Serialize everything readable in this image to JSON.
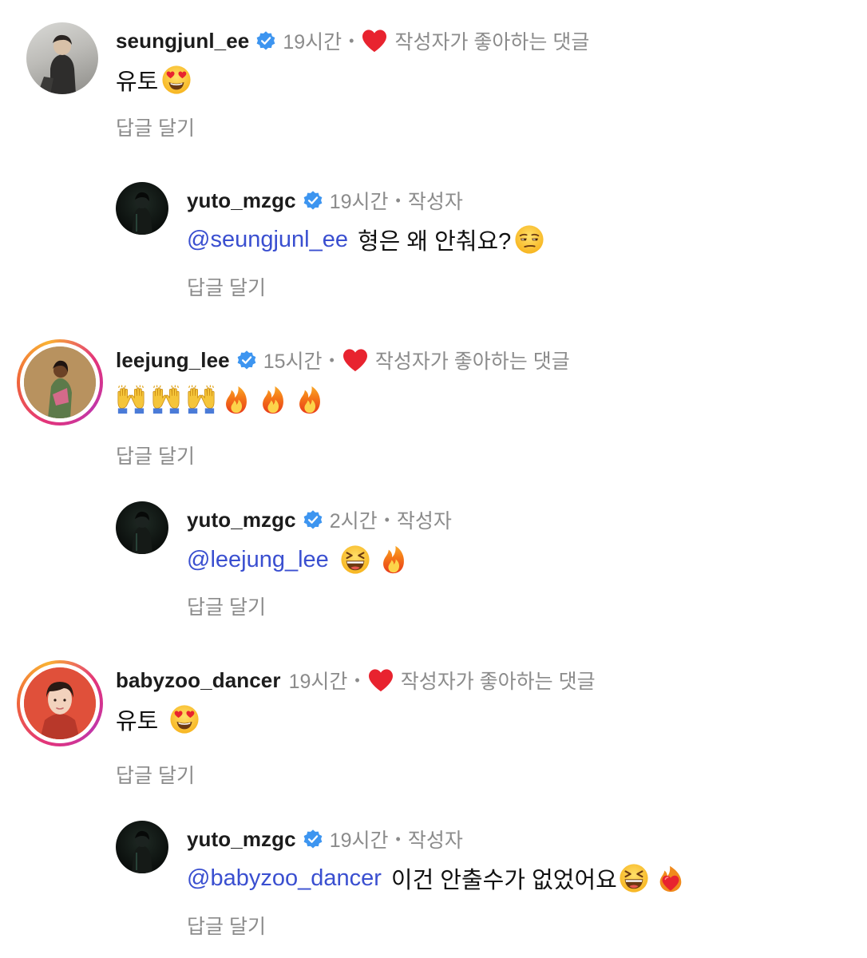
{
  "comments": [
    {
      "username": "seungjunl_ee",
      "time": "19시간",
      "liked_label": "작성자가 좋아하는 댓글",
      "text": "유토",
      "reply_label": "답글 달기"
    },
    {
      "username": "yuto_mzgc",
      "time": "19시간",
      "author_label": "작성자",
      "mention": "@seungjunl_ee",
      "text": "형은 왜 안춰요?",
      "reply_label": "답글 달기"
    },
    {
      "username": "leejung_lee",
      "time": "15시간",
      "liked_label": "작성자가 좋아하는 댓글",
      "reply_label": "답글 달기"
    },
    {
      "username": "yuto_mzgc",
      "time": "2시간",
      "author_label": "작성자",
      "mention": "@leejung_lee",
      "reply_label": "답글 달기"
    },
    {
      "username": "babyzoo_dancer",
      "time": "19시간",
      "liked_label": "작성자가 좋아하는 댓글",
      "text": "유토",
      "reply_label": "답글 달기"
    },
    {
      "username": "yuto_mzgc",
      "time": "19시간",
      "author_label": "작성자",
      "mention": "@babyzoo_dancer",
      "text": "이건 안출수가 없었어요",
      "reply_label": "답글 달기"
    }
  ],
  "icons": {
    "verified": "verified-badge-icon",
    "heart": "heart-icon",
    "emoji_heart_eyes": "heart-eyes-emoji",
    "emoji_unamused": "unamused-face-emoji",
    "emoji_raising_hands": "raising-hands-emoji",
    "emoji_fire": "fire-emoji",
    "emoji_laughing": "laughing-face-emoji",
    "emoji_heart_on_fire": "heart-on-fire-emoji"
  },
  "colors": {
    "mention": "#3a4fd0",
    "verified": "#3d95f0",
    "heart": "#e8232f",
    "muted": "#8b8b8b"
  }
}
